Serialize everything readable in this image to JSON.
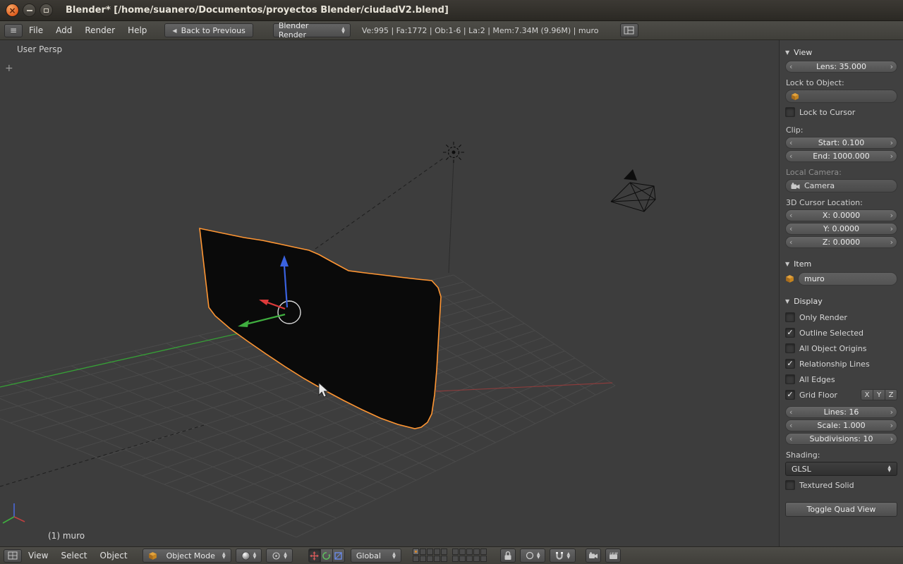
{
  "icons": {
    "close": "×",
    "section_arrow": "▼",
    "back_arrow": "◀",
    "menu_lines": "≡",
    "up": "▲",
    "down": "▼",
    "left": "‹",
    "right": "›",
    "check": "✓",
    "plus": "+"
  },
  "titlebar": {
    "title": "Blender* [/home/suanero/Documentos/proyectos Blender/ciudadV2.blend]"
  },
  "info_header": {
    "menus": {
      "file": "File",
      "add": "Add",
      "render": "Render",
      "help": "Help"
    },
    "back_button": "Back to Previous",
    "render_engine": "Blender Render",
    "stats": "Ve:995 | Fa:1772 | Ob:1-6 | La:2 | Mem:7.34M (9.96M) | muro"
  },
  "viewport": {
    "view_label": "User Persp",
    "active_object_label": "(1) muro",
    "colors": {
      "background": "#3d3d3d",
      "grid": "#4a4a4a",
      "selection_outline": "#ff9633",
      "axis_x": "#8a3c3c",
      "axis_y": "#36a136",
      "manipulator_x": "#dc3a3a",
      "manipulator_y": "#3fae3f",
      "manipulator_z": "#3a62e0"
    }
  },
  "n_panel": {
    "view": {
      "title": "View",
      "lens": "Lens: 35.000",
      "lock_to_object_label": "Lock to Object:",
      "lock_to_cursor_label": "Lock to Cursor",
      "lock_to_cursor_checked": false,
      "clip_label": "Clip:",
      "clip_start": "Start: 0.100",
      "clip_end": "End: 1000.000",
      "local_camera_label": "Local Camera:",
      "local_camera_value": "Camera",
      "cursor_location_label": "3D Cursor Location:",
      "cursor_x": "X: 0.0000",
      "cursor_y": "Y: 0.0000",
      "cursor_z": "Z: 0.0000"
    },
    "item": {
      "title": "Item",
      "object_name": "muro"
    },
    "display": {
      "title": "Display",
      "checkboxes": [
        {
          "label": "Only Render",
          "checked": false
        },
        {
          "label": "Outline Selected",
          "checked": true
        },
        {
          "label": "All Object Origins",
          "checked": false
        },
        {
          "label": "Relationship Lines",
          "checked": true
        },
        {
          "label": "All Edges",
          "checked": false
        }
      ],
      "grid_floor_label": "Grid Floor",
      "grid_floor_checked": true,
      "axis_toggles": [
        "X",
        "Y",
        "Z"
      ],
      "lines": "Lines: 16",
      "scale": "Scale: 1.000",
      "subdivisions": "Subdivisions: 10",
      "shading_label": "Shading:",
      "shading_mode": "GLSL",
      "textured_solid_label": "Textured Solid",
      "textured_solid_checked": false,
      "toggle_quad_view": "Toggle Quad View"
    }
  },
  "viewport_header": {
    "menus": {
      "view": "View",
      "select": "Select",
      "object": "Object"
    },
    "mode": "Object Mode",
    "orientation": "Global",
    "translate_active": true,
    "layer1_active": true
  }
}
